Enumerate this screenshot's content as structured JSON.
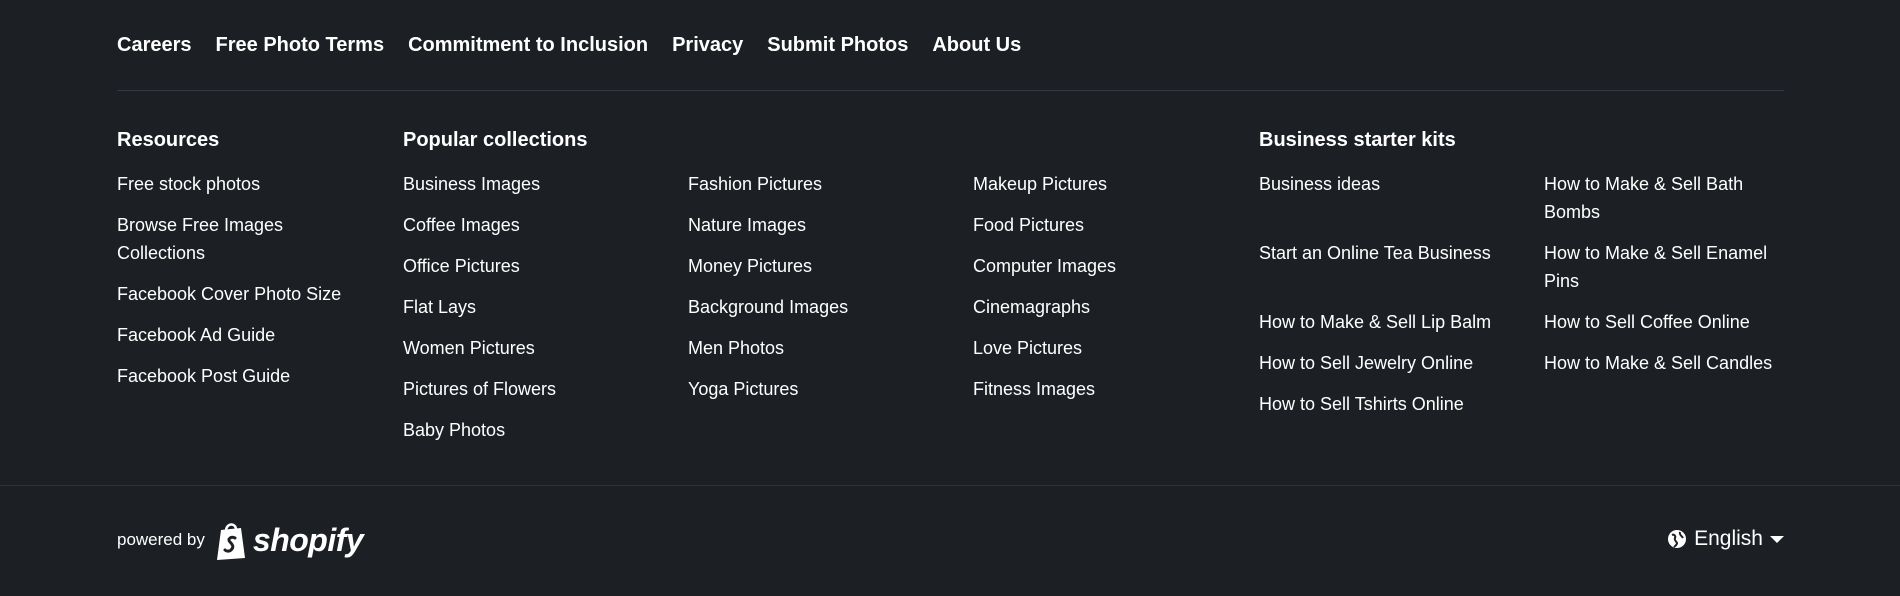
{
  "top_nav": {
    "items": [
      "Careers",
      "Free Photo Terms",
      "Commitment to Inclusion",
      "Privacy",
      "Submit Photos",
      "About Us"
    ]
  },
  "resources": {
    "heading": "Resources",
    "items": [
      "Free stock photos",
      "Browse Free Images Collections",
      "Facebook Cover Photo Size",
      "Facebook Ad Guide",
      "Facebook Post Guide"
    ]
  },
  "popular": {
    "heading": "Popular collections",
    "col1": [
      "Business Images",
      "Coffee Images",
      "Office Pictures",
      "Flat Lays",
      "Women Pictures",
      "Pictures of Flowers",
      "Baby Photos"
    ],
    "col2": [
      "Fashion Pictures",
      "Nature Images",
      "Money Pictures",
      "Background Images",
      "Men Photos",
      "Yoga Pictures"
    ],
    "col3": [
      "Makeup Pictures",
      "Food Pictures",
      "Computer Images",
      "Cinemagraphs",
      "Love Pictures",
      "Fitness Images"
    ]
  },
  "business_kits": {
    "heading": "Business starter kits",
    "col1": [
      "Business ideas",
      "Start an Online Tea Business",
      "How to Make & Sell Lip Balm",
      "How to Sell Jewelry Online",
      "How to Sell Tshirts Online"
    ],
    "col2": [
      "How to Make & Sell Bath Bombs",
      "How to Make & Sell Enamel Pins",
      "How to Sell Coffee Online",
      "How to Make & Sell Candles"
    ]
  },
  "footer": {
    "powered_by": "powered by",
    "brand": "shopify",
    "language": "English",
    "icons": {
      "brand": "shopify-bag-icon",
      "language": "globe-icon",
      "dropdown": "caret-down-icon"
    }
  },
  "colors": {
    "background": "#1c2025",
    "text": "#ffffff",
    "divider": "#33383f"
  }
}
